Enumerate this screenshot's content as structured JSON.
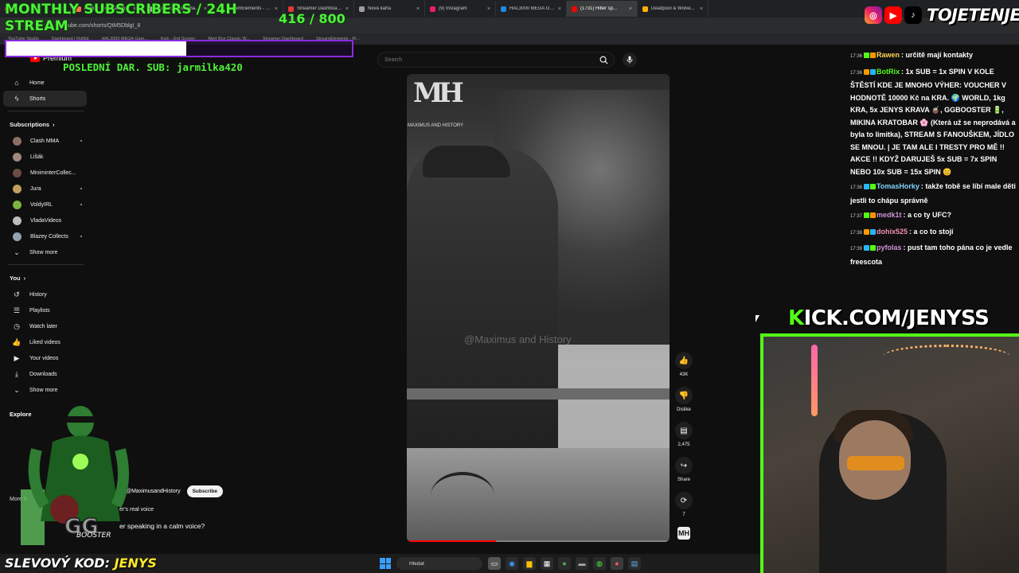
{
  "browser": {
    "tabs": [
      {
        "label": "",
        "color": "#e53935"
      },
      {
        "label": "Profil | The best Ch...",
        "color": "#ff7043"
      },
      {
        "label": "blerp.com/kick-cha...",
        "color": "#ffffff"
      },
      {
        "label": "StreamElements - C...",
        "color": "#90caf9"
      },
      {
        "label": "Streamer Dashboar...",
        "color": "#e53935"
      },
      {
        "label": "Nová karta",
        "color": "#9e9e9e"
      },
      {
        "label": "(9) Instagram",
        "color": "#e91e63"
      },
      {
        "label": "HAL3000 MEGA Ga...",
        "color": "#1e88e5"
      },
      {
        "label": "(1731) Hitler sp...",
        "color": "#ff0000",
        "active": true
      },
      {
        "label": "Deadpool & Wolve...",
        "color": "#ffb300"
      }
    ],
    "url": "youtube.com/shorts/QtM5DblgI_8",
    "bookmarks": [
      "YouTube Studio",
      "Dashboard | Rollbit",
      "HAL3000 MEGA Gam...",
      "Kick - 2nd Screen",
      "Alert Box Classic W...",
      "Streamer Dashboard",
      "StreamElements - M..."
    ]
  },
  "overlay": {
    "subs_title": "MONTHLY SUBSCRIBERS / 24H STREAM",
    "subs_count": "416  / 800",
    "subs_progress": 0.52,
    "last_donation": "POSLEDNÍ DAR. SUB: jarmilka420",
    "social_handle": "TOJETENJENYS",
    "kick_url_first": "K",
    "kick_url_rest": "ICK.COM/JENYSS",
    "promo_prefix": "SLEVOVÝ KOD:",
    "promo_code": "JENYS",
    "accent": "#53fc18"
  },
  "youtube": {
    "logo_text": "Premium",
    "search_placeholder": "Search",
    "sidebar": {
      "main": [
        {
          "label": "Home",
          "icon": "home-icon",
          "glyph": "⌂"
        },
        {
          "label": "Shorts",
          "icon": "shorts-icon",
          "glyph": "ϟ",
          "active": true
        }
      ],
      "subscriptions_title": "Subscriptions",
      "subscriptions": [
        {
          "label": "Clash MMA",
          "color": "#8d6e63",
          "dot": true
        },
        {
          "label": "Lišák",
          "color": "#a1887f",
          "dot": false
        },
        {
          "label": "MiniminterCollec...",
          "color": "#6d4c41",
          "dot": true
        },
        {
          "label": "Jura",
          "color": "#c0a060",
          "dot": true
        },
        {
          "label": "VoldyIRL",
          "color": "#7cb342",
          "dot": true
        },
        {
          "label": "VladaVideos",
          "color": "#bdbdbd",
          "dot": false
        },
        {
          "label": "Blazey Collects",
          "color": "#90a4ae",
          "dot": true
        }
      ],
      "show_more": "Show more",
      "you_title": "You",
      "you": [
        {
          "label": "History",
          "icon": "history-icon",
          "glyph": "↺"
        },
        {
          "label": "Playlists",
          "icon": "playlists-icon",
          "glyph": "☰"
        },
        {
          "label": "Watch later",
          "icon": "watch-later-icon",
          "glyph": "◷"
        },
        {
          "label": "Liked videos",
          "icon": "like-icon",
          "glyph": "👍"
        },
        {
          "label": "Your videos",
          "icon": "your-videos-icon",
          "glyph": "▶"
        },
        {
          "label": "Downloads",
          "icon": "download-icon",
          "glyph": "⤓"
        }
      ],
      "show_more_2": "Show more",
      "explore_title": "Explore",
      "more_from": "More fr"
    },
    "video": {
      "logo_mark": "MH",
      "logo_text": "MAXIMUS AND HISTORY",
      "watermark": "@Maximus and History",
      "progress": 0.34,
      "channel": "@MaximusandHistory",
      "subscribe": "Subscribe",
      "subtitle_1": "er's real voice",
      "title": "er speaking in a calm voice?"
    },
    "actions": [
      {
        "icon": "like-icon",
        "glyph": "👍",
        "label": "43K"
      },
      {
        "icon": "dislike-icon",
        "glyph": "👎",
        "label": "Dislike"
      },
      {
        "icon": "comment-icon",
        "glyph": "▤",
        "label": "2,475"
      },
      {
        "icon": "share-icon",
        "glyph": "↪",
        "label": "Share"
      },
      {
        "icon": "remix-icon",
        "glyph": "⟳",
        "label": "7"
      }
    ],
    "channel_thumb": "MH"
  },
  "chat": [
    {
      "time": "17:36",
      "user": "Rawen",
      "color": "#ffd54f",
      "text": "určitě mají kontakty"
    },
    {
      "time": "17:36",
      "user": "BotRix",
      "color": "#53fc18",
      "text": "1x SUB = 1x SPIN V KOLE ŠTĚSTÍ KDE JE MNOHO VÝHER: VOUCHER V HODNOTĚ 10000 Kč na KRA. 🌍 WORLD, 1kg KRA, 5x JENYS KRAVA 🧉, GGBOOSTER 🔋, MIKINA KRATOBAR 🌸 (Která už se neprodává a byla to limitka), STREAM S FANOUŠKEM, JÍDLO SE MNOU. | JE TAM ALE I TRESTY PRO MĚ !! AKCE !! KDYŽ DARUJEŠ 5x SUB = 7x SPIN NEBO 10x SUB = 15x SPIN 😊"
    },
    {
      "time": "17:36",
      "user": "TomasHorky",
      "color": "#81d4fa",
      "text": "takže tobě se líbí male děti jestli to chápu správně"
    },
    {
      "time": "17:37",
      "user": "medk1t",
      "color": "#ce93d8",
      "text": "a co ty UFC?"
    },
    {
      "time": "17:38",
      "user": "dohix525",
      "color": "#f48fb1",
      "text": "a co to stojí"
    },
    {
      "time": "17:39",
      "user": "pyfolas",
      "color": "#ce93d8",
      "text": "pust tam toho pána co je vedle freescota"
    }
  ],
  "taskbar": {
    "search_label": "Hledat"
  }
}
